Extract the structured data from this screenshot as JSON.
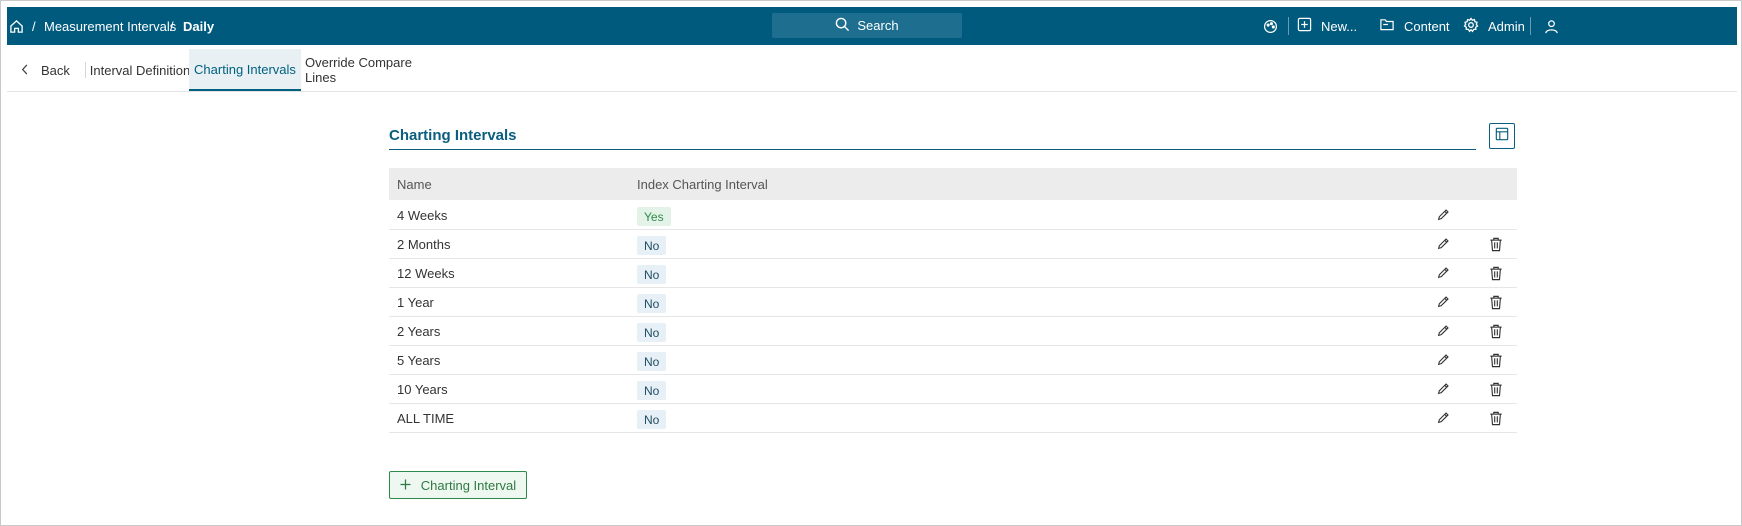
{
  "topbar": {
    "breadcrumb": [
      {
        "label": "Measurement Intervals"
      },
      {
        "label": "Daily"
      }
    ],
    "separator": "/",
    "search_label": "Search",
    "new_label": "New...",
    "content_label": "Content",
    "admin_label": "Admin",
    "home_icon": "home-icon",
    "background_color": "#005a7d"
  },
  "tabs": {
    "back_label": "Back",
    "items": [
      {
        "label": "Interval Definition"
      },
      {
        "label": "Charting Intervals"
      },
      {
        "label": "Override Compare Lines"
      }
    ],
    "active_index": 1
  },
  "section": {
    "title": "Charting Intervals"
  },
  "table": {
    "columns": [
      "Name",
      "Index Charting Interval"
    ],
    "rows": [
      {
        "name": "4 Weeks",
        "index": "Yes",
        "deletable": false
      },
      {
        "name": "2 Months",
        "index": "No",
        "deletable": true
      },
      {
        "name": "12 Weeks",
        "index": "No",
        "deletable": true
      },
      {
        "name": "1 Year",
        "index": "No",
        "deletable": true
      },
      {
        "name": "2 Years",
        "index": "No",
        "deletable": true
      },
      {
        "name": "5 Years",
        "index": "No",
        "deletable": true
      },
      {
        "name": "10 Years",
        "index": "No",
        "deletable": true
      },
      {
        "name": "ALL TIME",
        "index": "No",
        "deletable": true
      }
    ]
  },
  "add_button": {
    "label": "Charting Interval",
    "icon": "plus-icon"
  },
  "colors": {
    "accent": "#0b5e7e",
    "yes_badge": "#e4f3e8",
    "no_badge": "#e7f0f6",
    "add_button_border": "#2e8a4a"
  }
}
